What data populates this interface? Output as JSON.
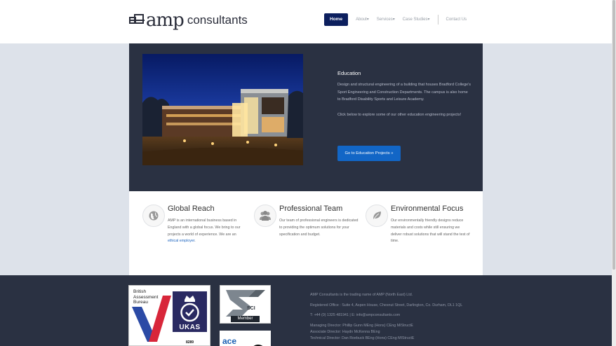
{
  "brand": {
    "amp": "amp",
    "consultants": "consultants"
  },
  "nav": {
    "home": "Home",
    "about": "About",
    "services": "Services",
    "case_studies": "Case Studies",
    "contact": "Contact Us",
    "caret": "▾"
  },
  "hero": {
    "title": "Education",
    "body": "Design and structural engineering of a building that houses Bradford College's Sport Engineering and Construction Departments. The campus is also home to Bradford Disability Sports and Leisure Academy.",
    "body2": "Click below to explore some of our other education engineering projects!",
    "button": "Go to Education Projects »"
  },
  "features": [
    {
      "title": "Global Reach",
      "body": "AMP is an international business based in England with a global focus. We bring to our projects a world of experience. We are an",
      "link": "ethical employer",
      "after": ".",
      "icon": "globe-icon"
    },
    {
      "title": "Professional Team",
      "body": "Our team of professional engineers is dedicated to providing the optimum solutions for your specification and budget.",
      "icon": "team-icon"
    },
    {
      "title": "Environmental Focus",
      "body": "Our environmentally friendly designs reduce materials and costs while still ensuring we deliver robust solutions that will stand the test of time.",
      "icon": "leaf-icon"
    }
  ],
  "footer": {
    "bab": "British\nAssessment\nBureau",
    "ukas": "UKAS",
    "ukas_sub": "MANAGEMENT\nSYSTEMS",
    "ukas_num": "8289",
    "sci": "SCI",
    "sci_member": "Member",
    "acc": "ace",
    "trading": "AMP Consultants is the trading name of AMP (North East) Ltd.",
    "office": "Registered Office : Suite 4, Aspen House, Chesnut Street, Darlington, Co. Durham, DL1 1QL",
    "contact": "T: +44 (0) 1325 481941 | E: info@ampconsultants.com",
    "md": "Managing Director: Phillip Gunn MEng (Hons) CEng MIStructE",
    "ad": "Associate Director: Haydn McKenna BEng",
    "td": "Technical Director: Dan Roebuck BEng (Hons) CEng MIStructE"
  },
  "colors": {
    "nav_active": "#0c1f5e",
    "dark_panel": "#2a3142",
    "button": "#1266c6",
    "link": "#1f66c0"
  }
}
